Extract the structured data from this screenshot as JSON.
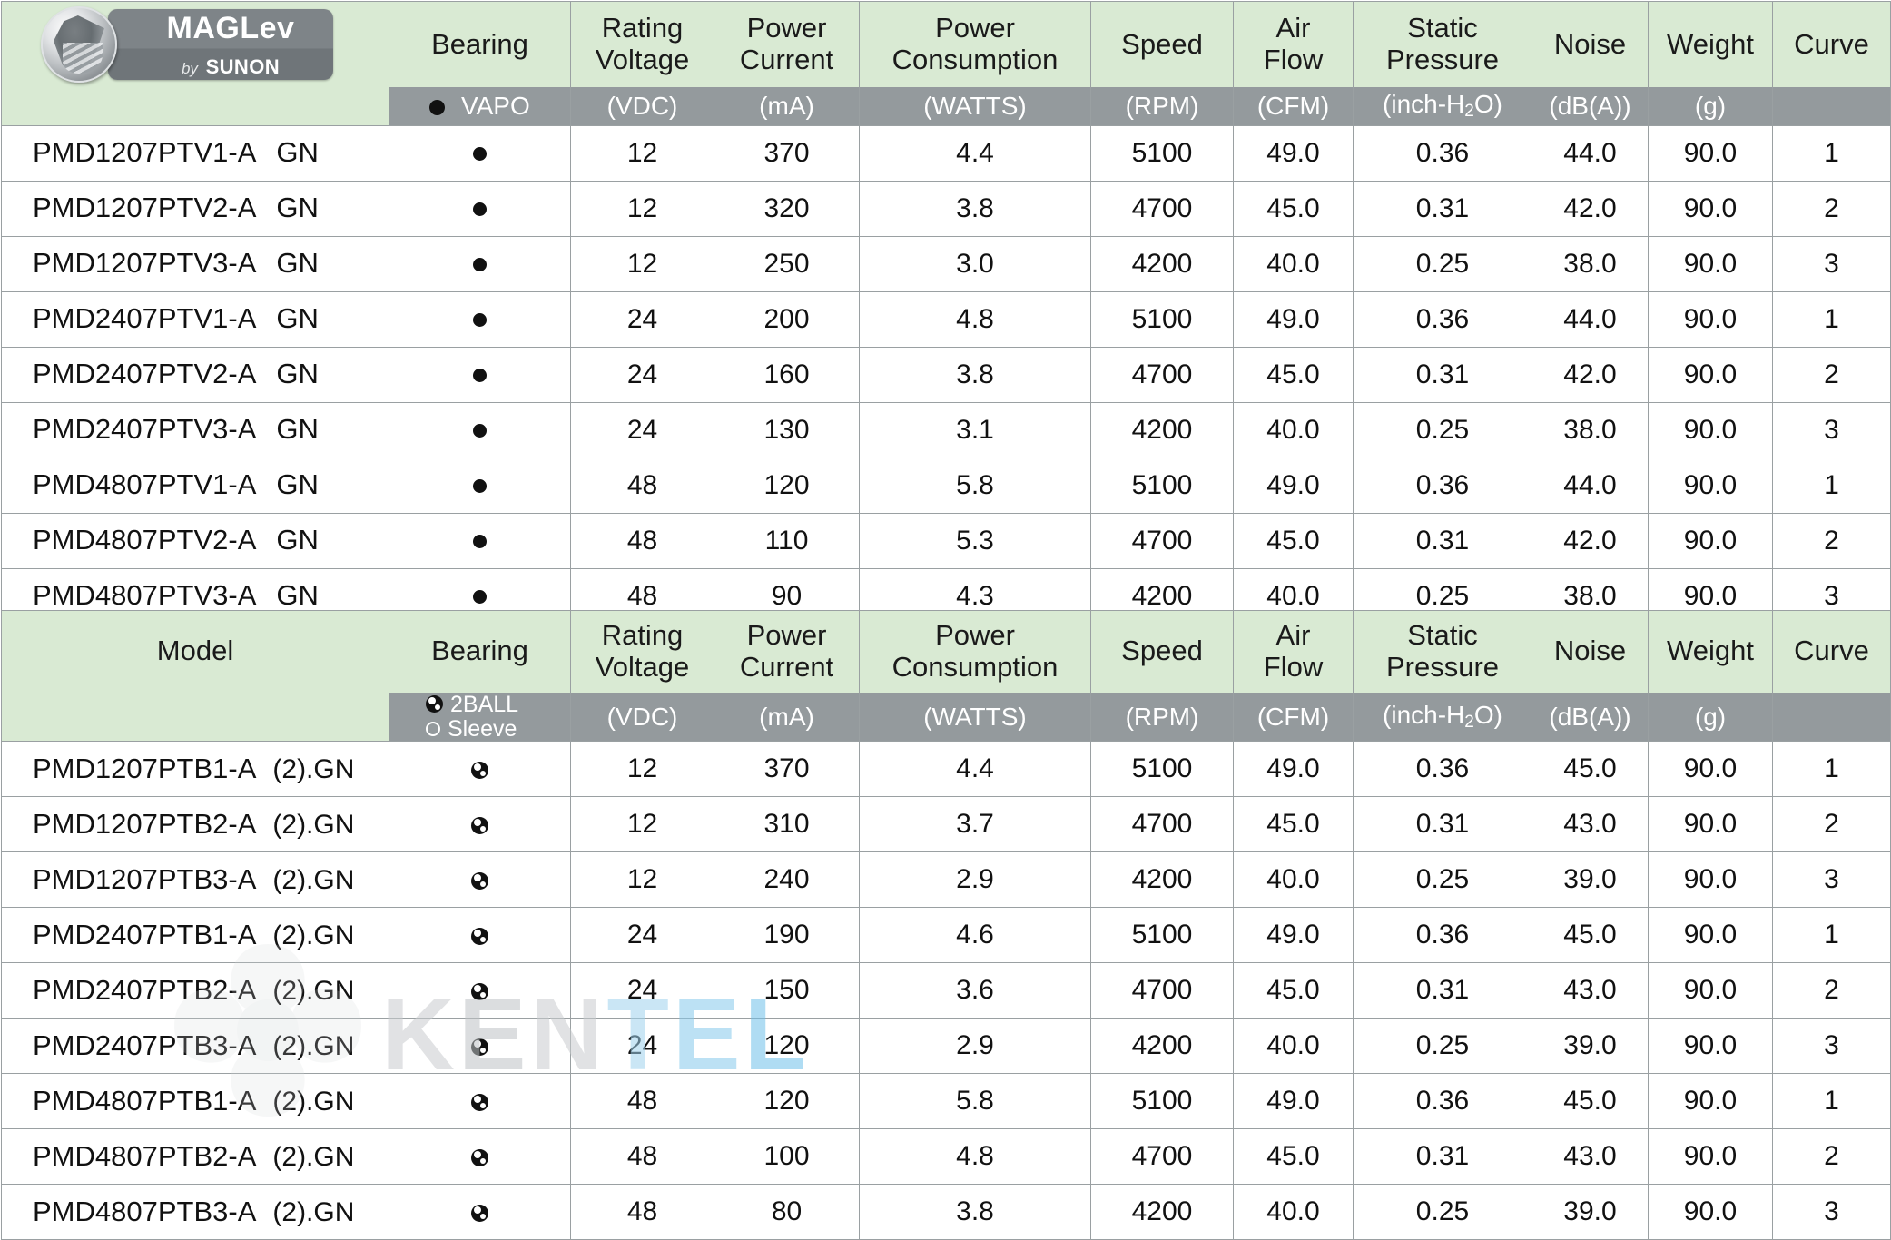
{
  "logo": {
    "brand_top": "MAGLev",
    "brand_by": "by",
    "brand_company": "SUNON",
    "alt": "MAGLev by SUNON"
  },
  "watermark": {
    "text_parts": [
      "K",
      "E",
      "N",
      "T",
      "E",
      "L"
    ],
    "full_text": "KENTEL"
  },
  "columns": {
    "model": "Model",
    "bearing": "Bearing",
    "rating_voltage": "Rating\nVoltage",
    "rating_voltage_l1": "Rating",
    "rating_voltage_l2": "Voltage",
    "power_current_l1": "Power",
    "power_current_l2": "Current",
    "power_consumption_l1": "Power",
    "power_consumption_l2": "Consumption",
    "speed": "Speed",
    "air_flow_l1": "Air",
    "air_flow_l2": "Flow",
    "static_pressure_l1": "Static",
    "static_pressure_l2": "Pressure",
    "noise": "Noise",
    "weight": "Weight",
    "curve": "Curve"
  },
  "units": {
    "voltage": "(VDC)",
    "current": "(mA)",
    "consumption": "(WATTS)",
    "speed": "(RPM)",
    "air_flow": "(CFM)",
    "static_pressure_pre": "(inch-H",
    "static_pressure_sub": "2",
    "static_pressure_post": "O)",
    "noise": "(dB(A))",
    "weight": "(g)"
  },
  "colors": {
    "header_green": "#d9ead3",
    "units_gray": "#949a9d",
    "border_gray": "#9aa0a2",
    "text": "#111111"
  },
  "table1": {
    "bearing_legend": "VAPO",
    "bearing_symbol": "filled-dot",
    "rows": [
      {
        "model": "PMD1207PTV1-A",
        "suffix": "GN",
        "bearing": "filled-dot",
        "voltage": "12",
        "current": "370",
        "consumption": "4.4",
        "speed": "5100",
        "air_flow": "49.0",
        "static_pressure": "0.36",
        "noise": "44.0",
        "weight": "90.0",
        "curve": "1"
      },
      {
        "model": "PMD1207PTV2-A",
        "suffix": "GN",
        "bearing": "filled-dot",
        "voltage": "12",
        "current": "320",
        "consumption": "3.8",
        "speed": "4700",
        "air_flow": "45.0",
        "static_pressure": "0.31",
        "noise": "42.0",
        "weight": "90.0",
        "curve": "2"
      },
      {
        "model": "PMD1207PTV3-A",
        "suffix": "GN",
        "bearing": "filled-dot",
        "voltage": "12",
        "current": "250",
        "consumption": "3.0",
        "speed": "4200",
        "air_flow": "40.0",
        "static_pressure": "0.25",
        "noise": "38.0",
        "weight": "90.0",
        "curve": "3"
      },
      {
        "model": "PMD2407PTV1-A",
        "suffix": "GN",
        "bearing": "filled-dot",
        "voltage": "24",
        "current": "200",
        "consumption": "4.8",
        "speed": "5100",
        "air_flow": "49.0",
        "static_pressure": "0.36",
        "noise": "44.0",
        "weight": "90.0",
        "curve": "1"
      },
      {
        "model": "PMD2407PTV2-A",
        "suffix": "GN",
        "bearing": "filled-dot",
        "voltage": "24",
        "current": "160",
        "consumption": "3.8",
        "speed": "4700",
        "air_flow": "45.0",
        "static_pressure": "0.31",
        "noise": "42.0",
        "weight": "90.0",
        "curve": "2"
      },
      {
        "model": "PMD2407PTV3-A",
        "suffix": "GN",
        "bearing": "filled-dot",
        "voltage": "24",
        "current": "130",
        "consumption": "3.1",
        "speed": "4200",
        "air_flow": "40.0",
        "static_pressure": "0.25",
        "noise": "38.0",
        "weight": "90.0",
        "curve": "3"
      },
      {
        "model": "PMD4807PTV1-A",
        "suffix": "GN",
        "bearing": "filled-dot",
        "voltage": "48",
        "current": "120",
        "consumption": "5.8",
        "speed": "5100",
        "air_flow": "49.0",
        "static_pressure": "0.36",
        "noise": "44.0",
        "weight": "90.0",
        "curve": "1"
      },
      {
        "model": "PMD4807PTV2-A",
        "suffix": "GN",
        "bearing": "filled-dot",
        "voltage": "48",
        "current": "110",
        "consumption": "5.3",
        "speed": "4700",
        "air_flow": "45.0",
        "static_pressure": "0.31",
        "noise": "42.0",
        "weight": "90.0",
        "curve": "2"
      },
      {
        "model": "PMD4807PTV3-A",
        "suffix": "GN",
        "bearing": "filled-dot",
        "voltage": "48",
        "current": "90",
        "consumption": "4.3",
        "speed": "4200",
        "air_flow": "40.0",
        "static_pressure": "0.25",
        "noise": "38.0",
        "weight": "90.0",
        "curve": "3"
      }
    ]
  },
  "table2": {
    "model_label": "Model",
    "bearing_legend_ball": "2BALL",
    "bearing_legend_sleeve": "Sleeve",
    "rows": [
      {
        "model": "PMD1207PTB1-A",
        "suffix": "(2).GN",
        "bearing": "ball",
        "voltage": "12",
        "current": "370",
        "consumption": "4.4",
        "speed": "5100",
        "air_flow": "49.0",
        "static_pressure": "0.36",
        "noise": "45.0",
        "weight": "90.0",
        "curve": "1"
      },
      {
        "model": "PMD1207PTB2-A",
        "suffix": "(2).GN",
        "bearing": "ball",
        "voltage": "12",
        "current": "310",
        "consumption": "3.7",
        "speed": "4700",
        "air_flow": "45.0",
        "static_pressure": "0.31",
        "noise": "43.0",
        "weight": "90.0",
        "curve": "2"
      },
      {
        "model": "PMD1207PTB3-A",
        "suffix": "(2).GN",
        "bearing": "ball",
        "voltage": "12",
        "current": "240",
        "consumption": "2.9",
        "speed": "4200",
        "air_flow": "40.0",
        "static_pressure": "0.25",
        "noise": "39.0",
        "weight": "90.0",
        "curve": "3"
      },
      {
        "model": "PMD2407PTB1-A",
        "suffix": "(2).GN",
        "bearing": "ball",
        "voltage": "24",
        "current": "190",
        "consumption": "4.6",
        "speed": "5100",
        "air_flow": "49.0",
        "static_pressure": "0.36",
        "noise": "45.0",
        "weight": "90.0",
        "curve": "1"
      },
      {
        "model": "PMD2407PTB2-A",
        "suffix": "(2).GN",
        "bearing": "ball",
        "voltage": "24",
        "current": "150",
        "consumption": "3.6",
        "speed": "4700",
        "air_flow": "45.0",
        "static_pressure": "0.31",
        "noise": "43.0",
        "weight": "90.0",
        "curve": "2"
      },
      {
        "model": "PMD2407PTB3-A",
        "suffix": "(2).GN",
        "bearing": "ball",
        "voltage": "24",
        "current": "120",
        "consumption": "2.9",
        "speed": "4200",
        "air_flow": "40.0",
        "static_pressure": "0.25",
        "noise": "39.0",
        "weight": "90.0",
        "curve": "3"
      },
      {
        "model": "PMD4807PTB1-A",
        "suffix": "(2).GN",
        "bearing": "ball",
        "voltage": "48",
        "current": "120",
        "consumption": "5.8",
        "speed": "5100",
        "air_flow": "49.0",
        "static_pressure": "0.36",
        "noise": "45.0",
        "weight": "90.0",
        "curve": "1"
      },
      {
        "model": "PMD4807PTB2-A",
        "suffix": "(2).GN",
        "bearing": "ball",
        "voltage": "48",
        "current": "100",
        "consumption": "4.8",
        "speed": "4700",
        "air_flow": "45.0",
        "static_pressure": "0.31",
        "noise": "43.0",
        "weight": "90.0",
        "curve": "2"
      },
      {
        "model": "PMD4807PTB3-A",
        "suffix": "(2).GN",
        "bearing": "ball",
        "voltage": "48",
        "current": "80",
        "consumption": "3.8",
        "speed": "4200",
        "air_flow": "40.0",
        "static_pressure": "0.25",
        "noise": "39.0",
        "weight": "90.0",
        "curve": "3"
      }
    ]
  }
}
